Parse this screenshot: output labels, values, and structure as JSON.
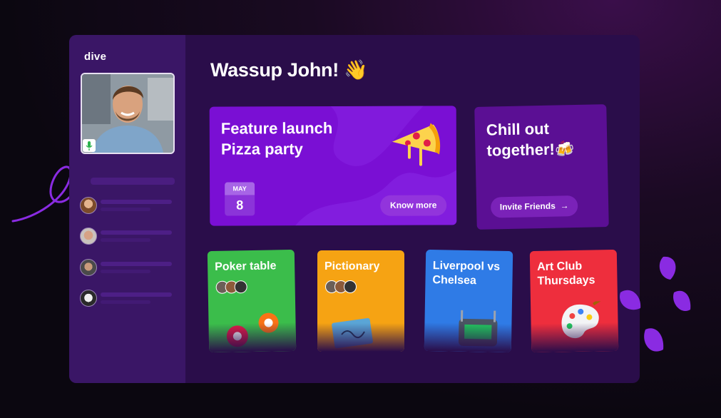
{
  "app": {
    "logo": "dive"
  },
  "greeting": "Wassup John! 👋",
  "hero": {
    "title_line1": "Feature launch",
    "title_line2": "Pizza party",
    "date_month": "MAY",
    "date_day": "8",
    "button_label": "Know more"
  },
  "side_card": {
    "title_line1": "Chill out",
    "title_line2": "together!🍻",
    "button_label": "Invite Friends",
    "button_icon": "arrow-right-icon"
  },
  "rooms": [
    {
      "title": "Poker table",
      "color": "#3bbd4b",
      "icon": "poker-chips-icon"
    },
    {
      "title": "Pictionary",
      "color": "#f6a313",
      "icon": "drawing-board-icon"
    },
    {
      "title": "Liverpool vs Chelsea",
      "color": "#2f7be6",
      "icon": "stadium-icon"
    },
    {
      "title": "Art Club Thursdays",
      "color": "#ee2e3d",
      "icon": "paint-palette-icon"
    }
  ],
  "colors": {
    "accent": "#7a0fd4",
    "sidebar": "#3a1666",
    "window": "#2a0d4a"
  }
}
